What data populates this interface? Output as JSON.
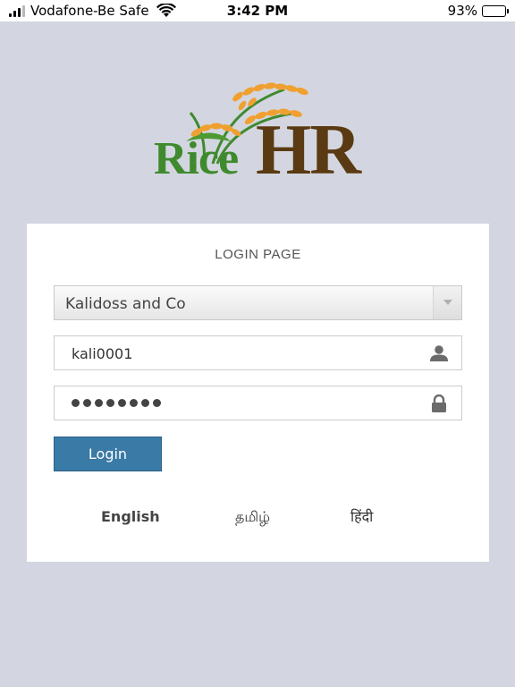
{
  "status_bar": {
    "carrier": "Vodafone-Be Safe",
    "time": "3:42 PM",
    "battery": "93%",
    "battery_level": 0.93,
    "signal_bars": 3,
    "signal_bars_total": 4
  },
  "logo": {
    "text_rice": "Rice",
    "text_hr": "HR",
    "colors": {
      "rice": "#3f8a2f",
      "hr": "#5a3a12",
      "grain": "#f0a030"
    }
  },
  "login": {
    "title": "LOGIN PAGE",
    "company_select": {
      "value": "Kalidoss and Co"
    },
    "username": {
      "value": "kali0001",
      "icon": "user-icon"
    },
    "password": {
      "masked_length": 8,
      "icon": "lock-icon"
    },
    "login_button": "Login",
    "accent_color": "#3a7aa6"
  },
  "languages": [
    "English",
    "தமிழ்",
    "हिंदी"
  ]
}
